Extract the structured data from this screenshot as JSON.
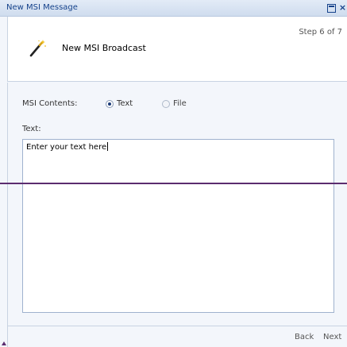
{
  "window": {
    "title": "New MSI Message"
  },
  "wizard": {
    "title": "New MSI Broadcast",
    "step": "Step 6 of 7",
    "icon": "wand-icon"
  },
  "form": {
    "contents_label": "MSI Contents:",
    "option_text": "Text",
    "option_file": "File",
    "selected_option": "Text",
    "text_label": "Text:",
    "text_value": "Enter your text here"
  },
  "footer": {
    "back_label": "Back",
    "next_label": "Next"
  },
  "colors": {
    "title_text": "#15428b",
    "divider": "#5b2c6f"
  }
}
